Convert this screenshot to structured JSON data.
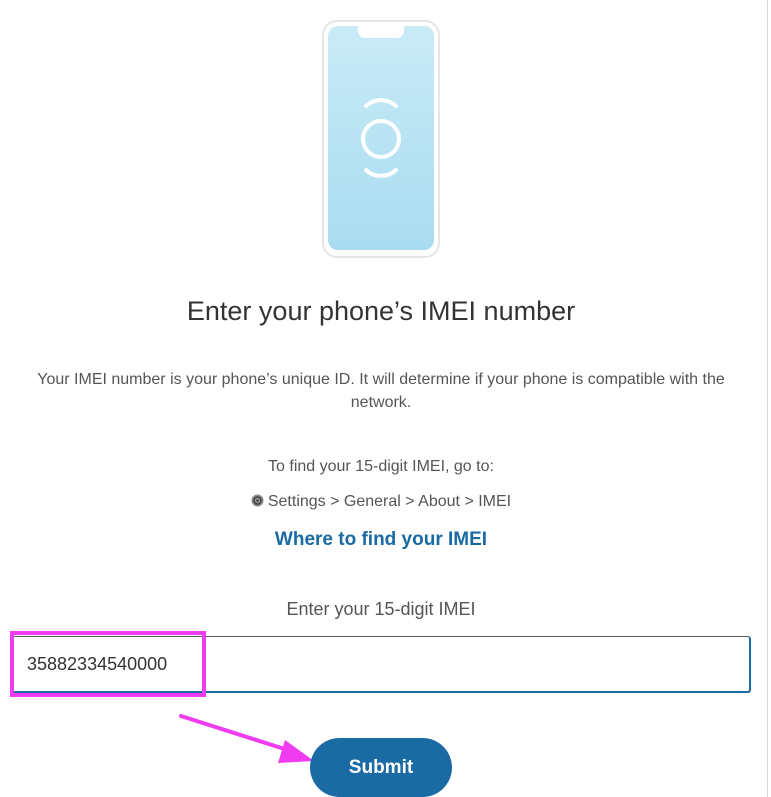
{
  "illustration": {
    "name": "phone-face-id-icon"
  },
  "heading": "Enter your phone’s IMEI number",
  "description": "Your IMEI number is your phone’s unique ID. It will determine if your phone is compatible with the network.",
  "instructions": {
    "find_text": "To find your 15-digit IMEI, go to:",
    "settings_icon": "settings-gear-icon",
    "settings_path": "Settings > General > About > IMEI"
  },
  "help_link": "Where to find your IMEI",
  "imei_field": {
    "label": "Enter your 15-digit IMEI",
    "value": "35882334540000"
  },
  "submit_label": "Submit",
  "annotations": {
    "highlight_color": "#f03cf0",
    "arrow_color": "#f03cf0"
  },
  "colors": {
    "brand_blue": "#1a6aa3",
    "phone_screen": "#bfe6f4"
  }
}
